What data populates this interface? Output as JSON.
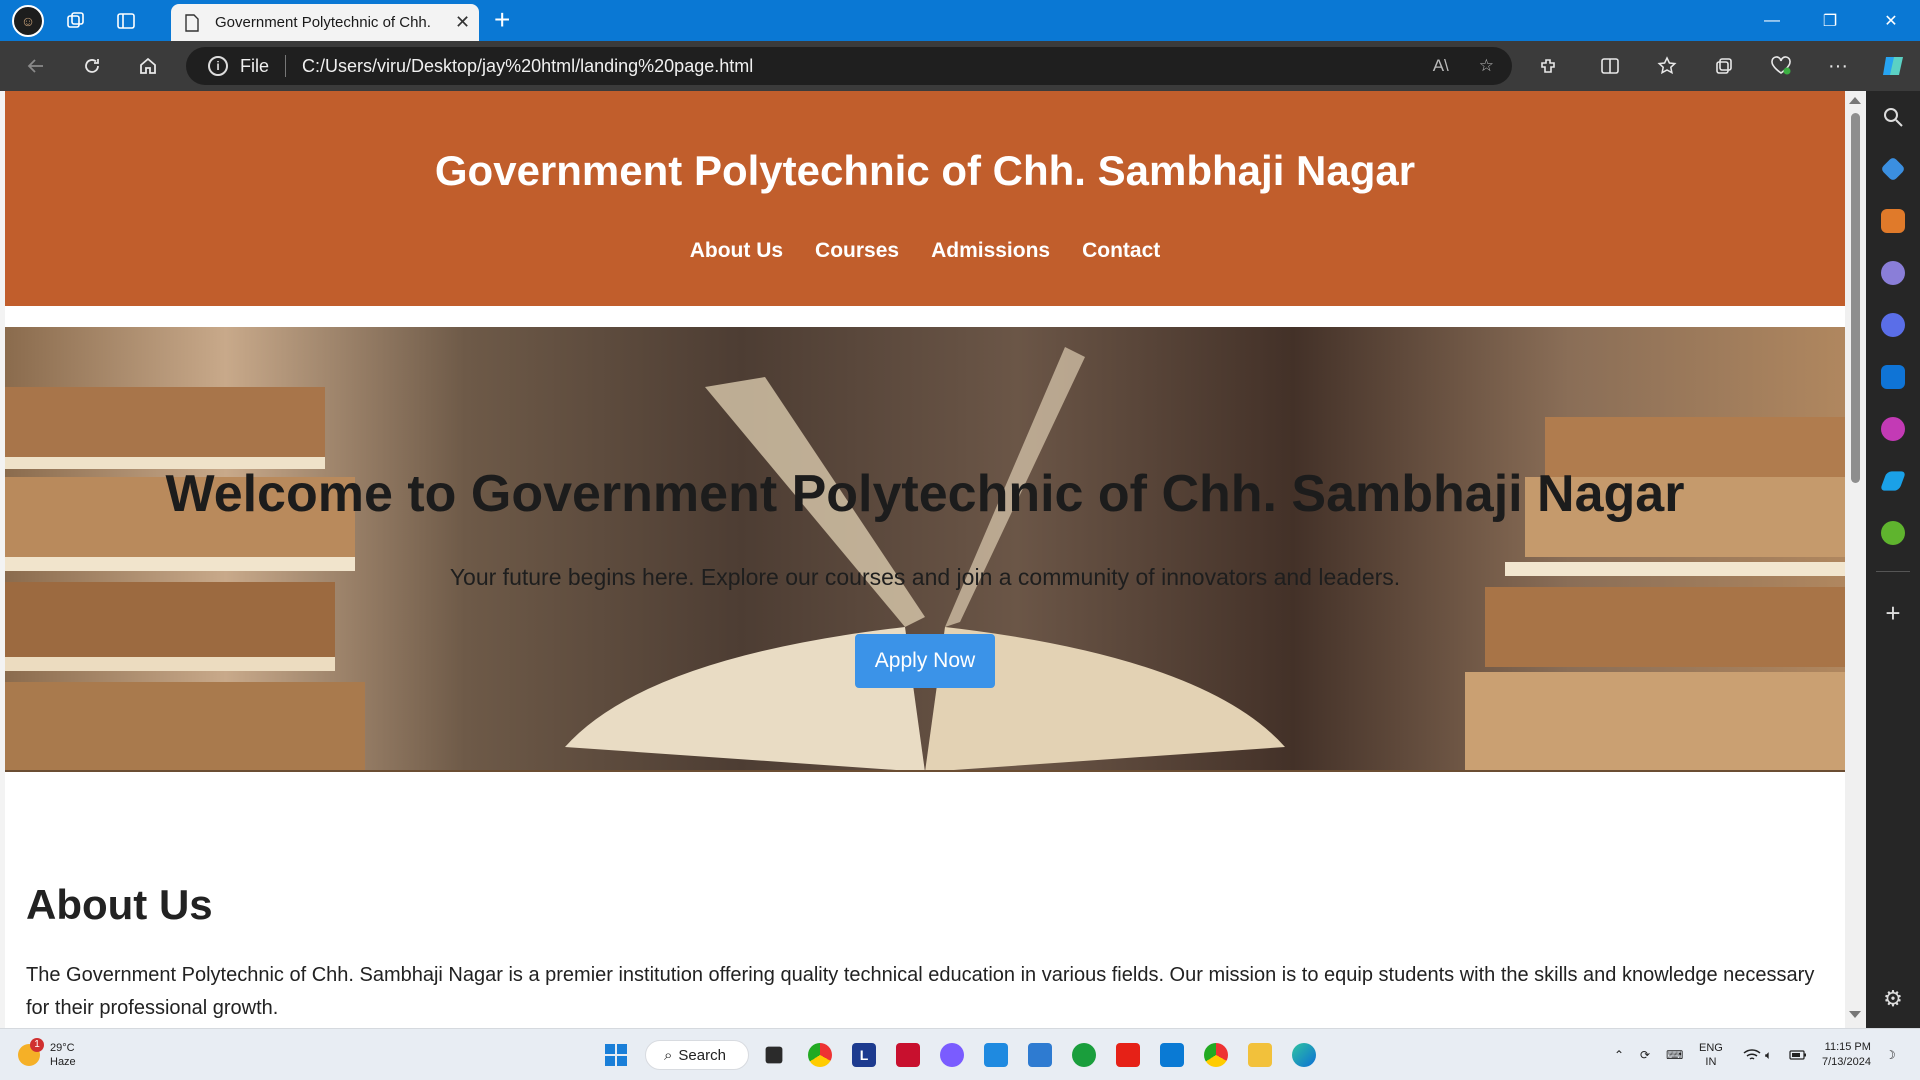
{
  "browser": {
    "tab_title": "Government Polytechnic of Chh.",
    "address_scheme": "File",
    "address_url": "C:/Users/viru/Desktop/jay%20html/landing%20page.html"
  },
  "site": {
    "title": "Government Polytechnic of Chh. Sambhaji Nagar",
    "nav": [
      "About Us",
      "Courses",
      "Admissions",
      "Contact"
    ]
  },
  "hero": {
    "title": "Welcome to Government Polytechnic of Chh. Sambhaji Nagar",
    "subtitle": "Your future begins here. Explore our courses and join a community of innovators and leaders.",
    "cta": "Apply Now"
  },
  "about": {
    "heading": "About Us",
    "text": "The Government Polytechnic of Chh. Sambhaji Nagar is a premier institution offering quality technical education in various fields. Our mission is to equip students with the skills and knowledge necessary for their professional growth."
  },
  "taskbar": {
    "weather_temp": "29°C",
    "weather_desc": "Haze",
    "weather_badge": "1",
    "search_label": "Search",
    "lang_top": "ENG",
    "lang_bottom": "IN",
    "time": "11:15 PM",
    "date": "7/13/2024"
  },
  "colors": {
    "header_bg": "#c15e2c",
    "button_bg": "#3b93e8",
    "browser_accent": "#0a78d4"
  }
}
